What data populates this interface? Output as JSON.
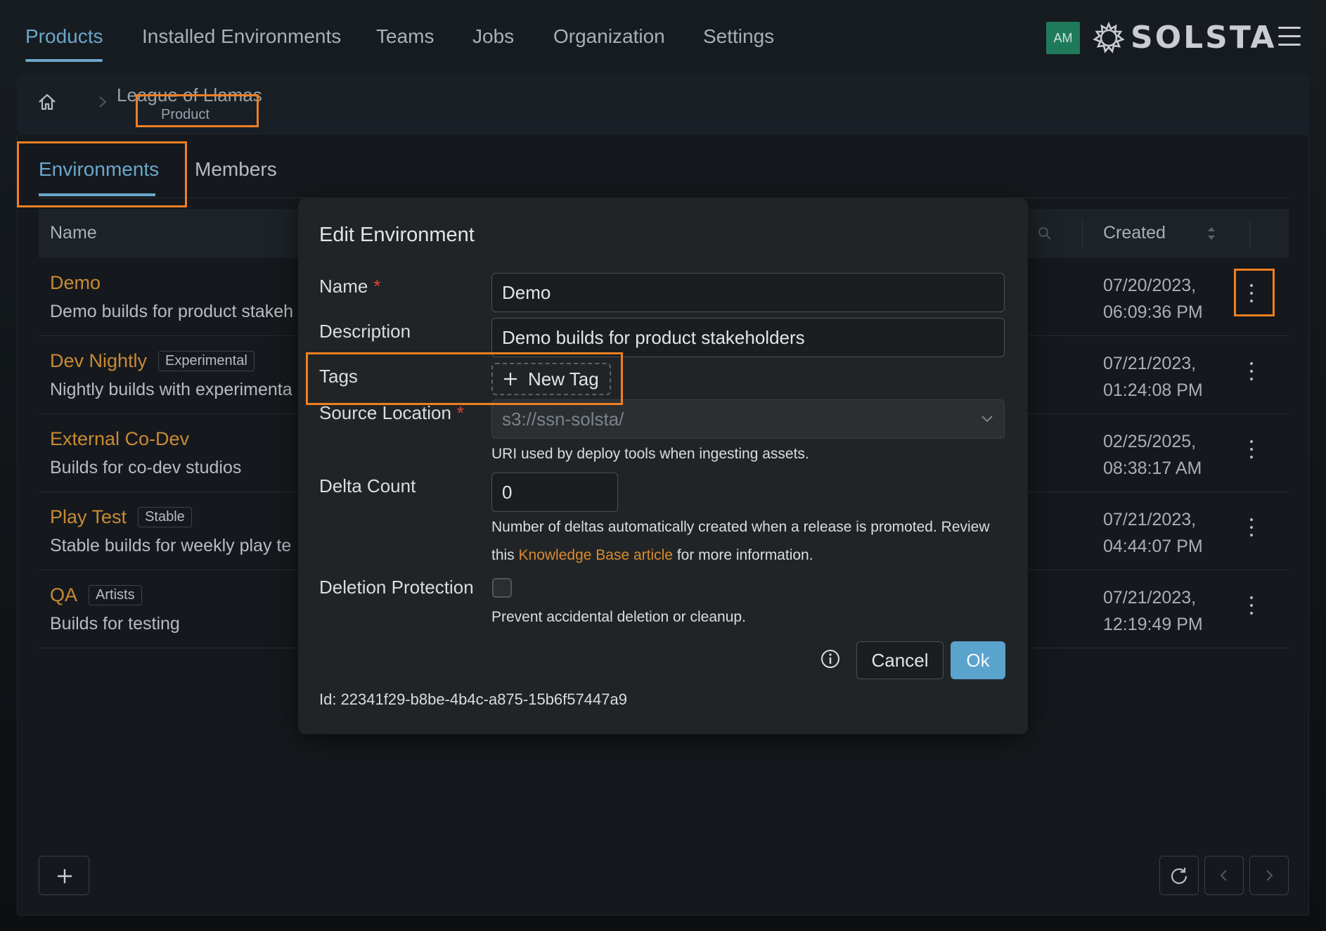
{
  "nav": {
    "items": [
      "Products",
      "Installed Environments",
      "Teams",
      "Jobs",
      "Organization",
      "Settings"
    ],
    "active_index": 0,
    "avatar_initials": "AM",
    "logo_text": "SOLSTA",
    "accent_color": "#6aa7cc",
    "highlight_color": "#f07f22"
  },
  "breadcrumb": {
    "title": "League of Llamas",
    "subtitle": "Product"
  },
  "tabs": [
    "Environments",
    "Members"
  ],
  "table": {
    "columns": [
      "Name",
      "Created"
    ],
    "rows": [
      {
        "name": "Demo",
        "tag": "",
        "description": "Demo builds for product stakeh",
        "created_line1": "07/20/2023,",
        "created_line2": "06:09:36 PM"
      },
      {
        "name": "Dev Nightly",
        "tag": "Experimental",
        "description": "Nightly builds with experimenta",
        "created_line1": "07/21/2023,",
        "created_line2": "01:24:08 PM"
      },
      {
        "name": "External Co-Dev",
        "tag": "",
        "description": "Builds for co-dev studios",
        "created_line1": "02/25/2025,",
        "created_line2": "08:38:17 AM"
      },
      {
        "name": "Play Test",
        "tag": "Stable",
        "description": "Stable builds for weekly play te",
        "created_line1": "07/21/2023,",
        "created_line2": "04:44:07 PM"
      },
      {
        "name": "QA",
        "tag": "Artists",
        "description": "Builds for testing",
        "created_line1": "07/21/2023,",
        "created_line2": "12:19:49 PM"
      }
    ]
  },
  "modal": {
    "title": "Edit Environment",
    "name_label": "Name",
    "name_value": "Demo",
    "description_label": "Description",
    "description_value": "Demo builds for product stakeholders",
    "tags_label": "Tags",
    "new_tag_label": "New Tag",
    "source_label": "Source Location",
    "source_value": "s3://ssn-solsta/",
    "source_help": "URI used by deploy tools when ingesting assets.",
    "delta_label": "Delta Count",
    "delta_value": "0",
    "delta_help_1": "Number of deltas automatically created when a release is promoted. Review",
    "delta_help_2a": "this ",
    "delta_help_link": "Knowledge Base article",
    "delta_help_2b": " for more information.",
    "deletion_label": "Deletion Protection",
    "deletion_checked": false,
    "deletion_help": "Prevent accidental deletion or cleanup.",
    "cancel_label": "Cancel",
    "ok_label": "Ok",
    "id_text": "Id: 22341f29-b8be-4b4c-a875-15b6f57447a9"
  }
}
